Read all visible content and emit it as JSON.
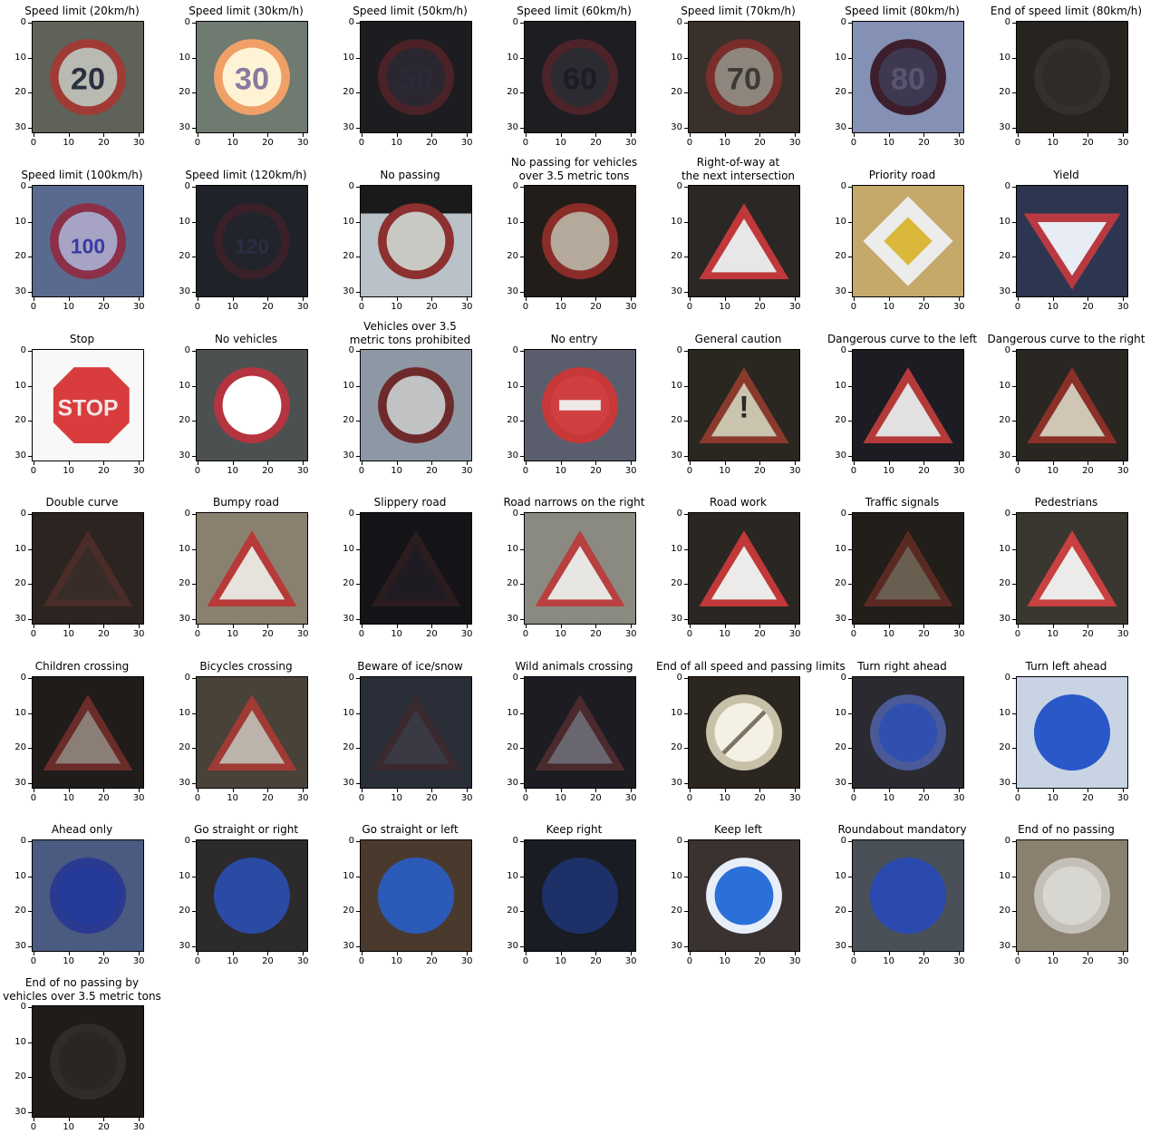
{
  "figure": {
    "ticks": [
      "0",
      "10",
      "20",
      "30"
    ],
    "panels": [
      {
        "title": "Speed limit (20km/h)",
        "shape": "circle",
        "bg": "#5f6259",
        "fill": "#b9bbb2",
        "ring": "#a03a34",
        "glyph": "20",
        "glyph_color": "#2c3140"
      },
      {
        "title": "Speed limit (30km/h)",
        "shape": "circle",
        "bg": "#6f7a70",
        "fill": "#fff3d6",
        "ring": "#f0a067",
        "glyph": "30",
        "glyph_color": "#8a7aa0"
      },
      {
        "title": "Speed limit (50km/h)",
        "shape": "circle",
        "bg": "#1d1c20",
        "fill": "#2a2730",
        "ring": "#4b2227",
        "glyph": "50",
        "glyph_color": "#2a2a3a"
      },
      {
        "title": "Speed limit (60km/h)",
        "shape": "circle",
        "bg": "#1e1d21",
        "fill": "#2c2b31",
        "ring": "#4b2328",
        "glyph": "60",
        "glyph_color": "#1c1d24"
      },
      {
        "title": "Speed limit (70km/h)",
        "shape": "circle",
        "bg": "#3a302b",
        "fill": "#8e867c",
        "ring": "#7a2d2a",
        "glyph": "70",
        "glyph_color": "#3c3a36"
      },
      {
        "title": "Speed limit (80km/h)",
        "shape": "circle",
        "bg": "#8490b4",
        "fill": "#3e3850",
        "ring": "#3c1e2c",
        "glyph": "80",
        "glyph_color": "#5a5470"
      },
      {
        "title": "End of speed limit (80km/h)",
        "shape": "circle",
        "bg": "#27231e",
        "fill": "#2f2c28",
        "ring": "#34302c",
        "glyph": "",
        "glyph_color": "#3c3a34"
      },
      {
        "title": "Speed limit (100km/h)",
        "shape": "circle",
        "bg": "#5a6a8e",
        "fill": "#a6a3c5",
        "ring": "#8c2f48",
        "glyph": "100",
        "glyph_color": "#3a3aa4"
      },
      {
        "title": "Speed limit (120km/h)",
        "shape": "circle",
        "bg": "#1f2228",
        "fill": "#22242c",
        "ring": "#3a2028",
        "glyph": "120",
        "glyph_color": "#2a2e44"
      },
      {
        "title": "No passing",
        "shape": "circle",
        "bg": "#b8c2c8",
        "fill": "#c9c9c4",
        "ring": "#8c3030",
        "glyph": "",
        "glyph_color": "#222",
        "band": "#1a1a1a"
      },
      {
        "title": "No passing for vehicles\nover 3.5 metric tons",
        "shape": "circle",
        "bg": "#231d1a",
        "fill": "#b4a99a",
        "ring": "#8a2c28",
        "glyph": "",
        "glyph_color": "#6a2a22"
      },
      {
        "title": "Right-of-way at\nthe next intersection",
        "shape": "triangle",
        "bg": "#2a2724",
        "fill": "#e7e6e8",
        "ring": "#c0383a",
        "glyph": "",
        "glyph_color": "#1c1c1c"
      },
      {
        "title": "Priority road",
        "shape": "diamond",
        "bg": "#c5a96a",
        "fill": "#ececea",
        "ring": "#d9b83a",
        "glyph": "",
        "glyph_color": "#222"
      },
      {
        "title": "Yield",
        "shape": "itriangle",
        "bg": "#2e3550",
        "fill": "#e8ecf4",
        "ring": "#b83a40",
        "glyph": "",
        "glyph_color": "#222"
      },
      {
        "title": "Stop",
        "shape": "octagon",
        "bg": "#f8f8f8",
        "fill": "#d83c3c",
        "ring": "#d83c3c",
        "glyph": "STOP",
        "glyph_color": "#f4e6e6"
      },
      {
        "title": "No vehicles",
        "shape": "circle",
        "bg": "#4c5050",
        "fill": "#ffffff",
        "ring": "#b43440",
        "glyph": "",
        "glyph_color": "#fff"
      },
      {
        "title": "Vehicles over 3.5\nmetric tons prohibited",
        "shape": "circle",
        "bg": "#8e98a4",
        "fill": "#c0c2c4",
        "ring": "#6e2a2a",
        "glyph": "",
        "glyph_color": "#1c1c1c"
      },
      {
        "title": "No entry",
        "shape": "circle",
        "bg": "#5a5e6c",
        "fill": "#d04040",
        "ring": "#c83838",
        "glyph": "",
        "glyph_color": "#f0f0f0",
        "bar": "#f0e8e8"
      },
      {
        "title": "General caution",
        "shape": "triangle",
        "bg": "#2a2620",
        "fill": "#cac3ae",
        "ring": "#8a3a2c",
        "glyph": "!",
        "glyph_color": "#2a2a20"
      },
      {
        "title": "Dangerous curve to the left",
        "shape": "triangle",
        "bg": "#1c1c22",
        "fill": "#e2e0e0",
        "ring": "#b43a3a",
        "glyph": "",
        "glyph_color": "#111"
      },
      {
        "title": "Dangerous curve to the right",
        "shape": "triangle",
        "bg": "#2a2622",
        "fill": "#cfc6b6",
        "ring": "#8a3028",
        "glyph": "",
        "glyph_color": "#1c1c1c"
      },
      {
        "title": "Double curve",
        "shape": "triangle",
        "bg": "#2c2420",
        "fill": "#372c28",
        "ring": "#4a2c28",
        "glyph": "",
        "glyph_color": "#2c2420"
      },
      {
        "title": "Bumpy road",
        "shape": "triangle",
        "bg": "#8a8070",
        "fill": "#e6e2dc",
        "ring": "#b83a38",
        "glyph": "",
        "glyph_color": "#222"
      },
      {
        "title": "Slippery road",
        "shape": "triangle",
        "bg": "#141418",
        "fill": "#1e1c22",
        "ring": "#2c1c20",
        "glyph": "",
        "glyph_color": "#141418"
      },
      {
        "title": "Road narrows on the right",
        "shape": "triangle",
        "bg": "#8a8a80",
        "fill": "#e8e6e2",
        "ring": "#b84040",
        "glyph": "",
        "glyph_color": "#222"
      },
      {
        "title": "Road work",
        "shape": "triangle",
        "bg": "#2a2622",
        "fill": "#ecebea",
        "ring": "#c03838",
        "glyph": "",
        "glyph_color": "#111"
      },
      {
        "title": "Traffic signals",
        "shape": "triangle",
        "bg": "#221e1a",
        "fill": "#6a5e50",
        "ring": "#5a2a22",
        "glyph": "",
        "glyph_color": "#2a2a24"
      },
      {
        "title": "Pedestrians",
        "shape": "triangle",
        "bg": "#3a3630",
        "fill": "#ecebea",
        "ring": "#c84040",
        "glyph": "",
        "glyph_color": "#1c1c1c"
      },
      {
        "title": "Children crossing",
        "shape": "triangle",
        "bg": "#201c1a",
        "fill": "#8a7e76",
        "ring": "#6a2c28",
        "glyph": "",
        "glyph_color": "#2a2826"
      },
      {
        "title": "Bicycles crossing",
        "shape": "triangle",
        "bg": "#484238",
        "fill": "#bcb4aa",
        "ring": "#a03a34",
        "glyph": "",
        "glyph_color": "#2c2a28"
      },
      {
        "title": "Beware of ice/snow",
        "shape": "triangle",
        "bg": "#2a2e38",
        "fill": "#3a3a44",
        "ring": "#3a2a30",
        "glyph": "",
        "glyph_color": "#2a2a34"
      },
      {
        "title": "Wild animals crossing",
        "shape": "triangle",
        "bg": "#1c1c22",
        "fill": "#6a6670",
        "ring": "#4a2a2c",
        "glyph": "",
        "glyph_color": "#1c1c1c"
      },
      {
        "title": "End of all speed and passing limits",
        "shape": "circle",
        "bg": "#2c2620",
        "fill": "#f4f0e4",
        "ring": "#c8c0a8",
        "glyph": "",
        "glyph_color": "#8a8270",
        "slash": "#7a7464"
      },
      {
        "title": "Turn right ahead",
        "shape": "circle",
        "bg": "#2a2a30",
        "fill": "#3050b0",
        "ring": "#4a5a98",
        "glyph": "",
        "glyph_color": "#e8e8f0"
      },
      {
        "title": "Turn left ahead",
        "shape": "circle",
        "bg": "#c8d4e4",
        "fill": "#2a58c8",
        "ring": "#2a58c8",
        "glyph": "",
        "glyph_color": "#f0f0f4"
      },
      {
        "title": "Ahead only",
        "shape": "circle",
        "bg": "#4a5a80",
        "fill": "#233a98",
        "ring": "#2a3a90",
        "glyph": "",
        "glyph_color": "#e0e0ea"
      },
      {
        "title": "Go straight or right",
        "shape": "circle",
        "bg": "#2c2a2a",
        "fill": "#2a4aa4",
        "ring": "#2a4aa4",
        "glyph": "",
        "glyph_color": "#d8dce8"
      },
      {
        "title": "Go straight or left",
        "shape": "circle",
        "bg": "#4a3a2e",
        "fill": "#2c5ab8",
        "ring": "#2c5ab8",
        "glyph": "",
        "glyph_color": "#d8dce8"
      },
      {
        "title": "Keep right",
        "shape": "circle",
        "bg": "#1a1c24",
        "fill": "#1e3068",
        "ring": "#1e3068",
        "glyph": "",
        "glyph_color": "#3a4a78"
      },
      {
        "title": "Keep left",
        "shape": "circle",
        "bg": "#3a3230",
        "fill": "#2a70d8",
        "ring": "#e8eef8",
        "glyph": "",
        "glyph_color": "#f0f4f8"
      },
      {
        "title": "Roundabout mandatory",
        "shape": "circle",
        "bg": "#4a5058",
        "fill": "#2a4ab0",
        "ring": "#2a4ab0",
        "glyph": "",
        "glyph_color": "#e0e4f0"
      },
      {
        "title": "End of no passing",
        "shape": "circle",
        "bg": "#8a8070",
        "fill": "#d8d6d0",
        "ring": "#c4c0b8",
        "glyph": "",
        "glyph_color": "#6a6860"
      },
      {
        "title": "End of no passing by\nvehicles over 3.5 metric tons",
        "shape": "circle",
        "bg": "#201c1a",
        "fill": "#2a2624",
        "ring": "#302c28",
        "glyph": "",
        "glyph_color": "#3a3632"
      }
    ]
  }
}
